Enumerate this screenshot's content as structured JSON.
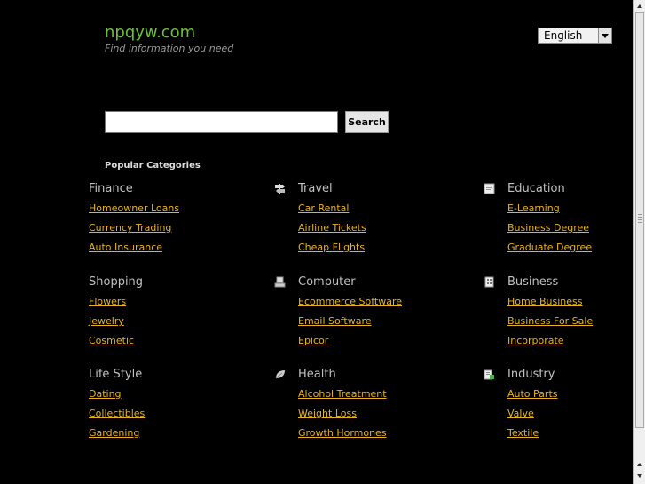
{
  "brand": {
    "site": "npqyw.com",
    "tagline": "Find information you need"
  },
  "language": {
    "selected": "English"
  },
  "search": {
    "button": "Search",
    "value": ""
  },
  "popular_label": "Popular Categories",
  "categories": [
    {
      "title": "Finance",
      "links": [
        "Homeowner Loans",
        "Currency Trading",
        "Auto Insurance"
      ]
    },
    {
      "title": "Travel",
      "icon": "signpost-icon",
      "links": [
        "Car Rental",
        "Airline Tickets",
        "Cheap Flights"
      ]
    },
    {
      "title": "Education",
      "icon": "book-icon",
      "links": [
        "E-Learning",
        "Business Degree",
        "Graduate Degree"
      ]
    },
    {
      "title": "Shopping",
      "links": [
        "Flowers",
        "Jewelry",
        "Cosmetic"
      ]
    },
    {
      "title": "Computer",
      "icon": "computer-icon",
      "links": [
        "Ecommerce Software",
        "Email Software",
        "Epicor"
      ]
    },
    {
      "title": "Business",
      "icon": "building-icon",
      "links": [
        "Home Business",
        "Business For Sale",
        "Incorporate"
      ]
    },
    {
      "title": "Life Style",
      "links": [
        "Dating",
        "Collectibles",
        "Gardening"
      ]
    },
    {
      "title": "Health",
      "icon": "leaf-icon",
      "links": [
        "Alcohol Treatment",
        "Weight Loss",
        "Growth Hormones"
      ]
    },
    {
      "title": "Industry",
      "icon": "factory-icon",
      "links": [
        "Auto Parts",
        "Valve",
        "Textile"
      ]
    }
  ],
  "colors": {
    "background": "#000000",
    "brand": "#6cbf3a",
    "link": "#e8b21c",
    "heading": "#c0c0c0"
  }
}
